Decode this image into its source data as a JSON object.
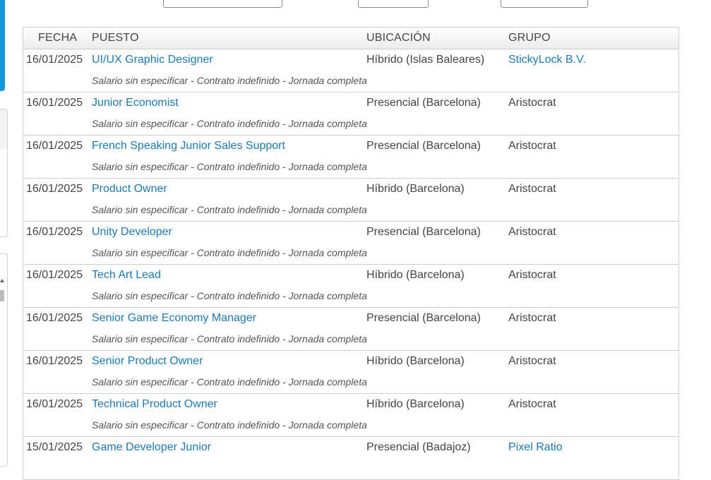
{
  "table": {
    "headers": {
      "fecha": "FECHA",
      "puesto": "PUESTO",
      "ubicacion": "UBICACIÓN",
      "grupo": "GRUPO"
    },
    "rows": [
      {
        "fecha": "16/01/2025",
        "puesto": "UI/UX Graphic Designer",
        "ubicacion": "Híbrido (Islas Baleares)",
        "grupo": "StickyLock B.V.",
        "grupo_is_link": true,
        "detalle": "Salario sin especificar - Contrato indefinido - Jornada completa"
      },
      {
        "fecha": "16/01/2025",
        "puesto": "Junior Economist",
        "ubicacion": "Presencial (Barcelona)",
        "grupo": "Aristocrat",
        "grupo_is_link": false,
        "detalle": "Salario sin especificar - Contrato indefinido - Jornada completa"
      },
      {
        "fecha": "16/01/2025",
        "puesto": "French Speaking Junior Sales Support",
        "ubicacion": "Presencial (Barcelona)",
        "grupo": "Aristocrat",
        "grupo_is_link": false,
        "detalle": "Salario sin especificar - Contrato indefinido - Jornada completa"
      },
      {
        "fecha": "16/01/2025",
        "puesto": "Product Owner",
        "ubicacion": "Híbrido (Barcelona)",
        "grupo": "Aristocrat",
        "grupo_is_link": false,
        "detalle": "Salario sin especificar - Contrato indefinido - Jornada completa"
      },
      {
        "fecha": "16/01/2025",
        "puesto": "Unity Developer",
        "ubicacion": "Presencial (Barcelona)",
        "grupo": "Aristocrat",
        "grupo_is_link": false,
        "detalle": "Salario sin especificar - Contrato indefinido - Jornada completa"
      },
      {
        "fecha": "16/01/2025",
        "puesto": "Tech Art Lead",
        "ubicacion": "Híbrido (Barcelona)",
        "grupo": "Aristocrat",
        "grupo_is_link": false,
        "detalle": "Salario sin especificar - Contrato indefinido - Jornada completa"
      },
      {
        "fecha": "16/01/2025",
        "puesto": "Senior Game Economy Manager",
        "ubicacion": "Presencial (Barcelona)",
        "grupo": "Aristocrat",
        "grupo_is_link": false,
        "detalle": "Salario sin especificar - Contrato indefinido - Jornada completa"
      },
      {
        "fecha": "16/01/2025",
        "puesto": "Senior Product Owner",
        "ubicacion": "Híbrido (Barcelona)",
        "grupo": "Aristocrat",
        "grupo_is_link": false,
        "detalle": "Salario sin especificar - Contrato indefinido - Jornada completa"
      },
      {
        "fecha": "16/01/2025",
        "puesto": "Technical Product Owner",
        "ubicacion": "Híbrido (Barcelona)",
        "grupo": "Aristocrat",
        "grupo_is_link": false,
        "detalle": "Salario sin especificar - Contrato indefinido - Jornada completa"
      },
      {
        "fecha": "15/01/2025",
        "puesto": "Game Developer Junior",
        "ubicacion": "Presencial (Badajoz)",
        "grupo": "Pixel Ratio",
        "grupo_is_link": true,
        "detalle": ""
      }
    ]
  },
  "colors": {
    "link": "#1a7ab8",
    "text": "#444444",
    "accent": "#1499d8",
    "border": "#cfcfcf"
  }
}
